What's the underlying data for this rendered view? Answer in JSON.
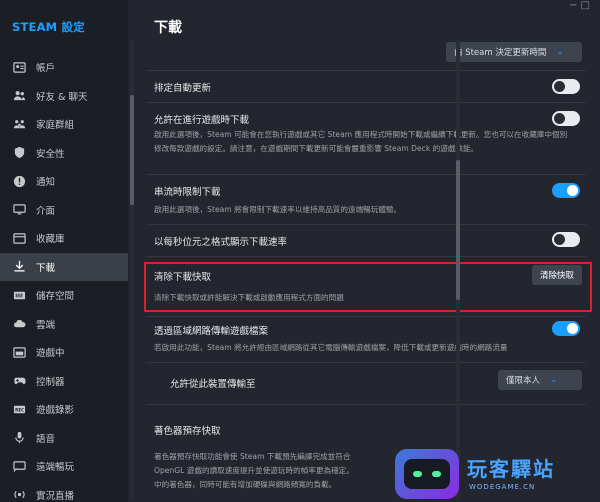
{
  "sidebar": {
    "title": "STEAM 設定",
    "items": [
      {
        "label": "帳戶",
        "icon": "account-icon"
      },
      {
        "label": "好友 & 聊天",
        "icon": "friends-icon"
      },
      {
        "label": "家庭群組",
        "icon": "family-icon"
      },
      {
        "label": "安全性",
        "icon": "shield-icon"
      },
      {
        "label": "通知",
        "icon": "notification-icon"
      },
      {
        "label": "介面",
        "icon": "monitor-icon"
      },
      {
        "label": "收藏庫",
        "icon": "library-icon"
      },
      {
        "label": "下載",
        "icon": "download-icon",
        "active": true
      },
      {
        "label": "儲存空間",
        "icon": "storage-icon"
      },
      {
        "label": "雲端",
        "icon": "cloud-icon"
      },
      {
        "label": "遊戲中",
        "icon": "ingame-icon"
      },
      {
        "label": "控制器",
        "icon": "controller-icon"
      },
      {
        "label": "遊戲錄影",
        "icon": "recording-icon"
      },
      {
        "label": "語音",
        "icon": "mic-icon"
      },
      {
        "label": "遠端暢玩",
        "icon": "remote-play-icon"
      },
      {
        "label": "實況直播",
        "icon": "broadcast-icon"
      }
    ]
  },
  "main": {
    "title": "下載",
    "window_ctrl": "−  □",
    "schedule_dropdown": "由 Steam 決定更新時間",
    "settings": [
      {
        "label": "排定自動更新",
        "desc": "",
        "toggle": false
      },
      {
        "label": "允許在進行遊戲時下載",
        "desc": "啟用此選項後，Steam 可能會在您執行遊戲或其它 Steam 應用程式時開始下載或繼續下載更新。您也可以在收藏庫中個別修改每款遊戲的設定。請注意，在遊戲期間下載更新可能會嚴重影響 Steam Deck 的遊戲效能。",
        "toggle": false
      },
      {
        "label": "串流時限制下載",
        "desc": "啟用此選項後，Steam 將會限制下載速率以維持高品質的遠端暢玩體驗。",
        "toggle": true
      },
      {
        "label": "以每秒位元之格式顯示下載速率",
        "desc": "",
        "toggle": false
      }
    ],
    "clear_cache": {
      "label": "清除下載快取",
      "button": "清除快取",
      "desc": "清除下載快取或許能解決下載或啟動應用程式方面的問題"
    },
    "lan_transfer": {
      "label": "透過區域網路傳輸遊戲檔案",
      "desc": "若啟用此功能，Steam 將允許經由區域網路從其它電腦傳輸遊戲檔案，降低下載或更新遊戲時的網路流量",
      "toggle": true,
      "sub_label": "允許從此裝置傳輸至",
      "sub_dropdown": "僅限本人"
    },
    "shader": {
      "label": "著色器預存快取",
      "desc1": "著色器預存快取功能會使 Steam 下載預先編譯完成並符合",
      "desc2": "OpenGL 遊戲的讀取速度提升並使遊玩時的幀率更為穩定。",
      "desc3": "中的著色器，同時可能有增加硬碟與網路頻寬的負載。",
      "desc2_tail": "Steam 將在需要時處理您系統"
    }
  },
  "watermark": {
    "text": "玩客驛站",
    "sub": "WODEGAME.CN"
  },
  "colors": {
    "accent": "#1a9fff",
    "highlight": "#d8222a"
  }
}
